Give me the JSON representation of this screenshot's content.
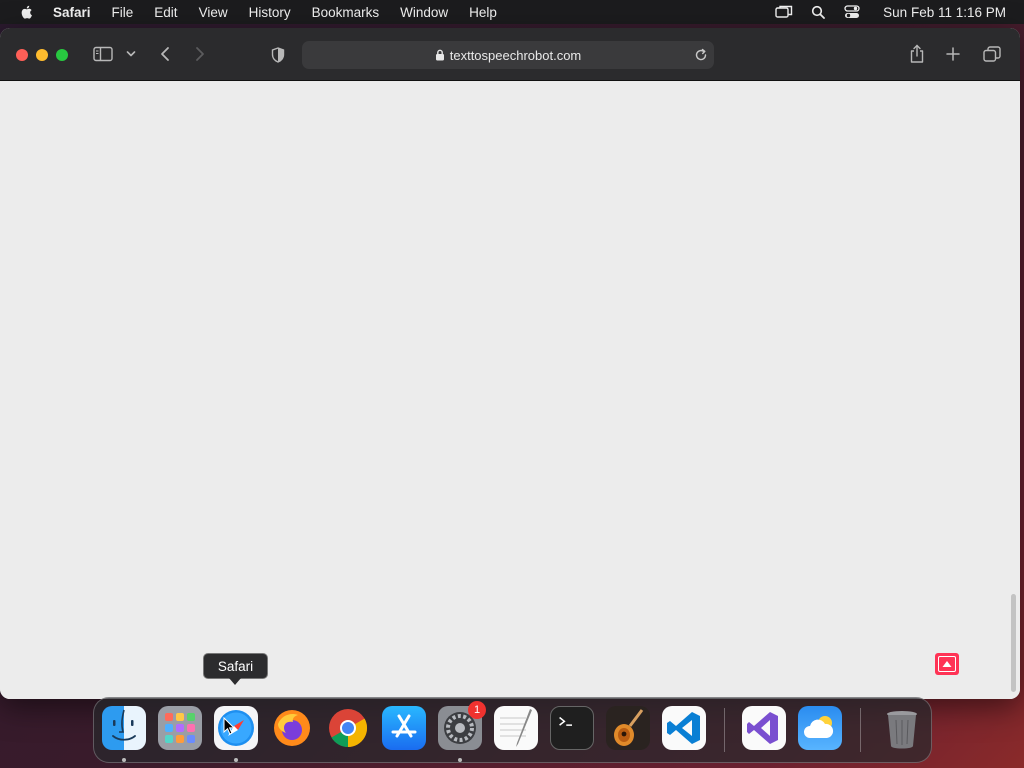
{
  "menubar": {
    "app_name": "Safari",
    "items": [
      "File",
      "Edit",
      "View",
      "History",
      "Bookmarks",
      "Window",
      "Help"
    ],
    "clock": "Sun Feb 11  1:16 PM"
  },
  "browser": {
    "url": "texttospeechrobot.com"
  },
  "tooltip": {
    "label": "Safari"
  },
  "dock": {
    "apps": [
      {
        "name": "Finder",
        "icon": "finder-icon",
        "running": true
      },
      {
        "name": "Launchpad",
        "icon": "launchpad-icon",
        "running": false
      },
      {
        "name": "Safari",
        "icon": "safari-icon",
        "running": true
      },
      {
        "name": "Firefox",
        "icon": "firefox-icon",
        "running": false
      },
      {
        "name": "Chrome",
        "icon": "chrome-icon",
        "running": false
      },
      {
        "name": "App Store",
        "icon": "app-store-icon",
        "running": false
      },
      {
        "name": "System Preferences",
        "icon": "system-preferences-icon",
        "running": true,
        "badge": "1"
      },
      {
        "name": "TextEdit",
        "icon": "textedit-icon",
        "running": false
      },
      {
        "name": "Terminal",
        "icon": "terminal-icon",
        "running": false
      },
      {
        "name": "GarageBand",
        "icon": "garageband-icon",
        "running": false
      },
      {
        "name": "Visual Studio Code",
        "icon": "vscode-icon",
        "running": false
      },
      {
        "name": "Visual Studio",
        "icon": "visual-studio-icon",
        "running": false
      },
      {
        "name": "Weather",
        "icon": "weather-icon",
        "running": false
      },
      {
        "name": "Trash",
        "icon": "trash-icon",
        "running": false
      }
    ],
    "system_preferences_badge": "1"
  },
  "colors": {
    "menubar_bg": "#1c1c1e",
    "toolbar_bg": "#2b2b2d",
    "content_bg": "#ececec",
    "close": "#fe5f57",
    "minimize": "#febc2e",
    "maximize": "#28c840",
    "scroll_top_button": "#ff3355"
  }
}
